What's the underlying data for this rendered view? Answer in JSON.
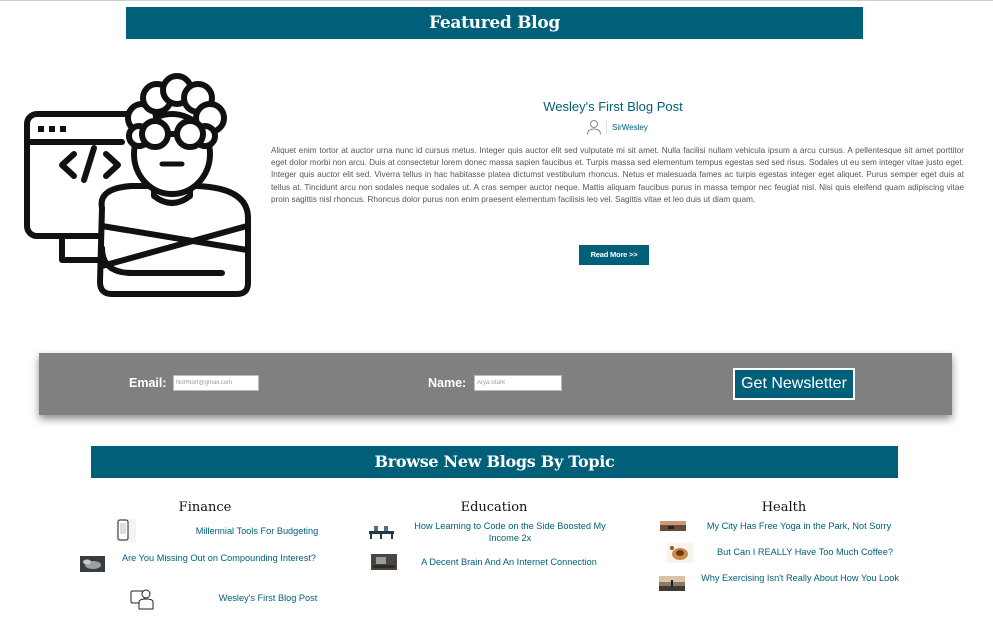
{
  "featured": {
    "heading": "Featured Blog",
    "post_title": "Wesley's First Blog Post",
    "author": "SirWesley",
    "body": "Aliquet enim tortor at auctor urna nunc id cursus metus. Integer quis auctor elit sed vulputate mi sit amet. Nulla facilisi nullam vehicula ipsum a arcu cursus. A pellentesque sit amet porttitor eget dolor morbi non arcu. Duis at consectetur lorem donec massa sapien faucibus et. Turpis massa sed elementum tempus egestas sed sed risus. Sodales ut eu sem integer vitae justo eget. Integer quis auctor elit sed. Viverra tellus in hac habitasse platea dictumst vestibulum rhoncus. Netus et malesuada fames ac turpis egestas integer eget aliquet. Purus semper eget duis at tellus at. Tincidunt arcu non sodales neque sodales ut. A cras semper auctor neque. Mattis aliquam faucibus purus in massa tempor nec feugiat nisl. Nisi quis eleifend quam adipiscing vitae proin sagittis nisl rhoncus. Rhoncus dolor purus non enim praesent elementum facilisis leo vel. Sagittis vitae et leo duis ut diam quam.",
    "read_more": "Read More >>"
  },
  "newsletter": {
    "email_label": "Email:",
    "email_placeholder": "NorfNorf@gmail.com",
    "name_label": "Name:",
    "name_placeholder": "Arya.Stark",
    "button": "Get Newsletter"
  },
  "browse": {
    "heading": "Browse New Blogs By Topic",
    "columns": [
      {
        "title": "Finance",
        "posts": [
          "Millennial Tools For Budgeting",
          "Are You Missing Out on Compounding Interest?",
          "Wesley's First Blog Post"
        ]
      },
      {
        "title": "Education",
        "posts": [
          "How Learning to Code on the Side Boosted My Income 2x",
          "A Decent Brain And An Internet Connection"
        ]
      },
      {
        "title": "Health",
        "posts": [
          "My City Has Free Yoga in the Park, Not Sorry",
          "But Can I REALLY Have Too Much Coffee?",
          "Why Exercising Isn't Really About How You Look"
        ]
      }
    ]
  },
  "colors": {
    "brand": "#00607a",
    "newsletter_bg": "#808080"
  },
  "icons": [
    "developer-illustration-icon",
    "user-icon",
    "phone-thumbnail-icon",
    "coins-thumbnail-icon",
    "developer-thumbnail-icon",
    "classroom-thumbnail-icon",
    "desk-thumbnail-icon",
    "yoga-thumbnail-icon",
    "coffee-thumbnail-icon",
    "exercise-thumbnail-icon"
  ]
}
